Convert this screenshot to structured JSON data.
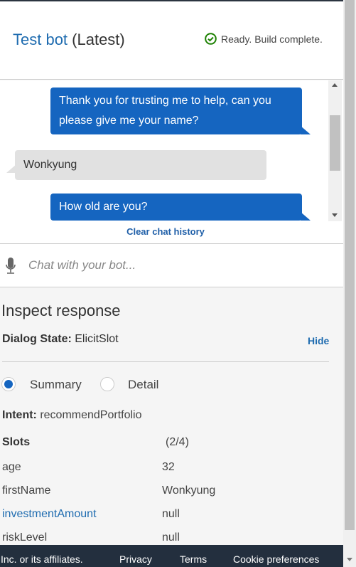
{
  "header": {
    "title_link": "Test bot",
    "title_suffix": " (Latest)",
    "status": "Ready. Build complete.",
    "status_color": "#1d8102"
  },
  "chat": {
    "messages": [
      {
        "from": "bot",
        "text": "Thank you for trusting me to help, can you please give me your name?"
      },
      {
        "from": "user",
        "text": "Wonkyung"
      },
      {
        "from": "bot",
        "text": "How old are you?"
      }
    ],
    "clear_label": "Clear chat history",
    "input_placeholder": "Chat with your bot...",
    "input_value": ""
  },
  "inspect": {
    "title": "Inspect response",
    "dialog_state_label": "Dialog State:",
    "dialog_state": "ElicitSlot",
    "hide_label": "Hide",
    "view_options": [
      {
        "label": "Summary",
        "selected": true
      },
      {
        "label": "Detail",
        "selected": false
      }
    ],
    "intent_label": "Intent:",
    "intent": "recommendPortfolio",
    "slots_label": "Slots",
    "slots_count": "(2/4)",
    "slots": [
      {
        "name": "age",
        "value": "32"
      },
      {
        "name": "firstName",
        "value": "Wonkyung"
      },
      {
        "name": "investmentAmount",
        "value": "null"
      },
      {
        "name": "riskLevel",
        "value": "null"
      }
    ]
  },
  "footer": {
    "copyright": "Inc. or its affiliates.",
    "privacy": "Privacy",
    "terms": "Terms",
    "cookies": "Cookie preferences"
  },
  "colors": {
    "accent": "#1565c0",
    "footer_bg": "#232f3e"
  }
}
